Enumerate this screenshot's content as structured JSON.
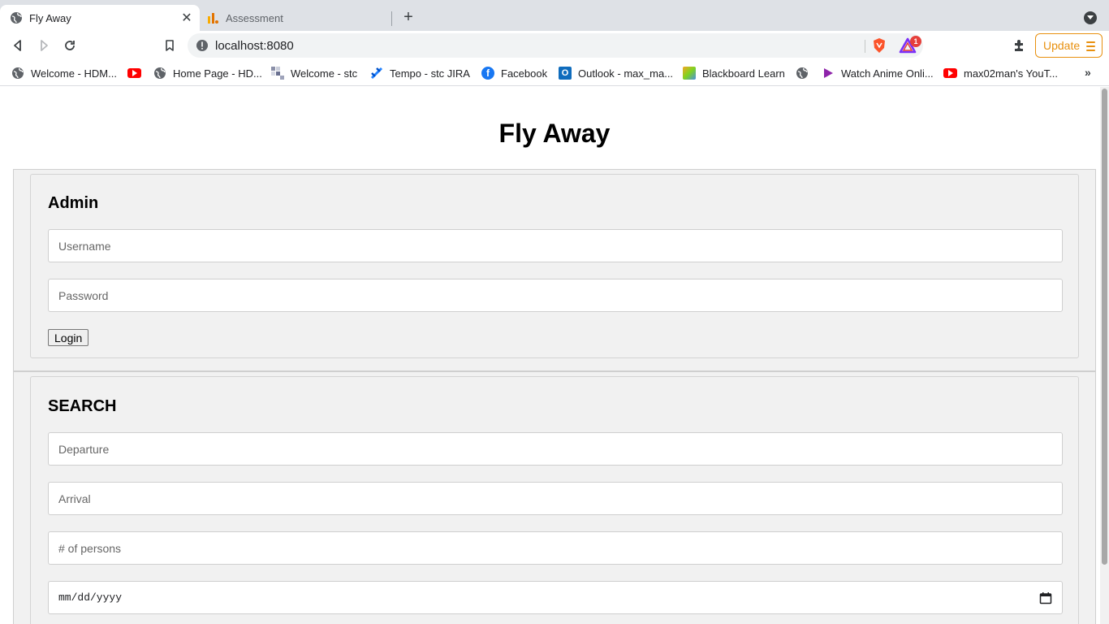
{
  "browser": {
    "tabs": [
      {
        "title": "Fly Away",
        "active": true
      },
      {
        "title": "Assessment",
        "active": false
      }
    ],
    "address": "localhost:8080",
    "rewards_badge": "1",
    "update_label": "Update",
    "bookmarks": [
      {
        "label": "Welcome - HDM...",
        "icon": "globe-icon"
      },
      {
        "label": "",
        "icon": "youtube-icon"
      },
      {
        "label": "Home Page - HD...",
        "icon": "globe-icon"
      },
      {
        "label": "Welcome - stc",
        "icon": "stc-icon"
      },
      {
        "label": "Tempo - stc JIRA",
        "icon": "jira-icon"
      },
      {
        "label": "Facebook",
        "icon": "facebook-icon"
      },
      {
        "label": "Outlook - max_ma...",
        "icon": "outlook-icon"
      },
      {
        "label": "Blackboard Learn",
        "icon": "blackboard-icon"
      },
      {
        "label": "",
        "icon": "globe-icon"
      },
      {
        "label": "Watch Anime Onli...",
        "icon": "play-icon"
      },
      {
        "label": "max02man's YouT...",
        "icon": "youtube-icon"
      }
    ],
    "more_bookmarks": "»"
  },
  "page": {
    "title": "Fly Away",
    "admin": {
      "heading": "Admin",
      "username_placeholder": "Username",
      "password_placeholder": "Password",
      "login_label": "Login"
    },
    "search": {
      "heading": "SEARCH",
      "departure_placeholder": "Departure",
      "arrival_placeholder": "Arrival",
      "persons_placeholder": "# of persons",
      "date_placeholder": "mm/dd/yyyy"
    }
  },
  "colors": {
    "accent_update": "#e8900f",
    "panel_bg": "#f1f1f1",
    "tabstrip_bg": "#dee1e6"
  }
}
